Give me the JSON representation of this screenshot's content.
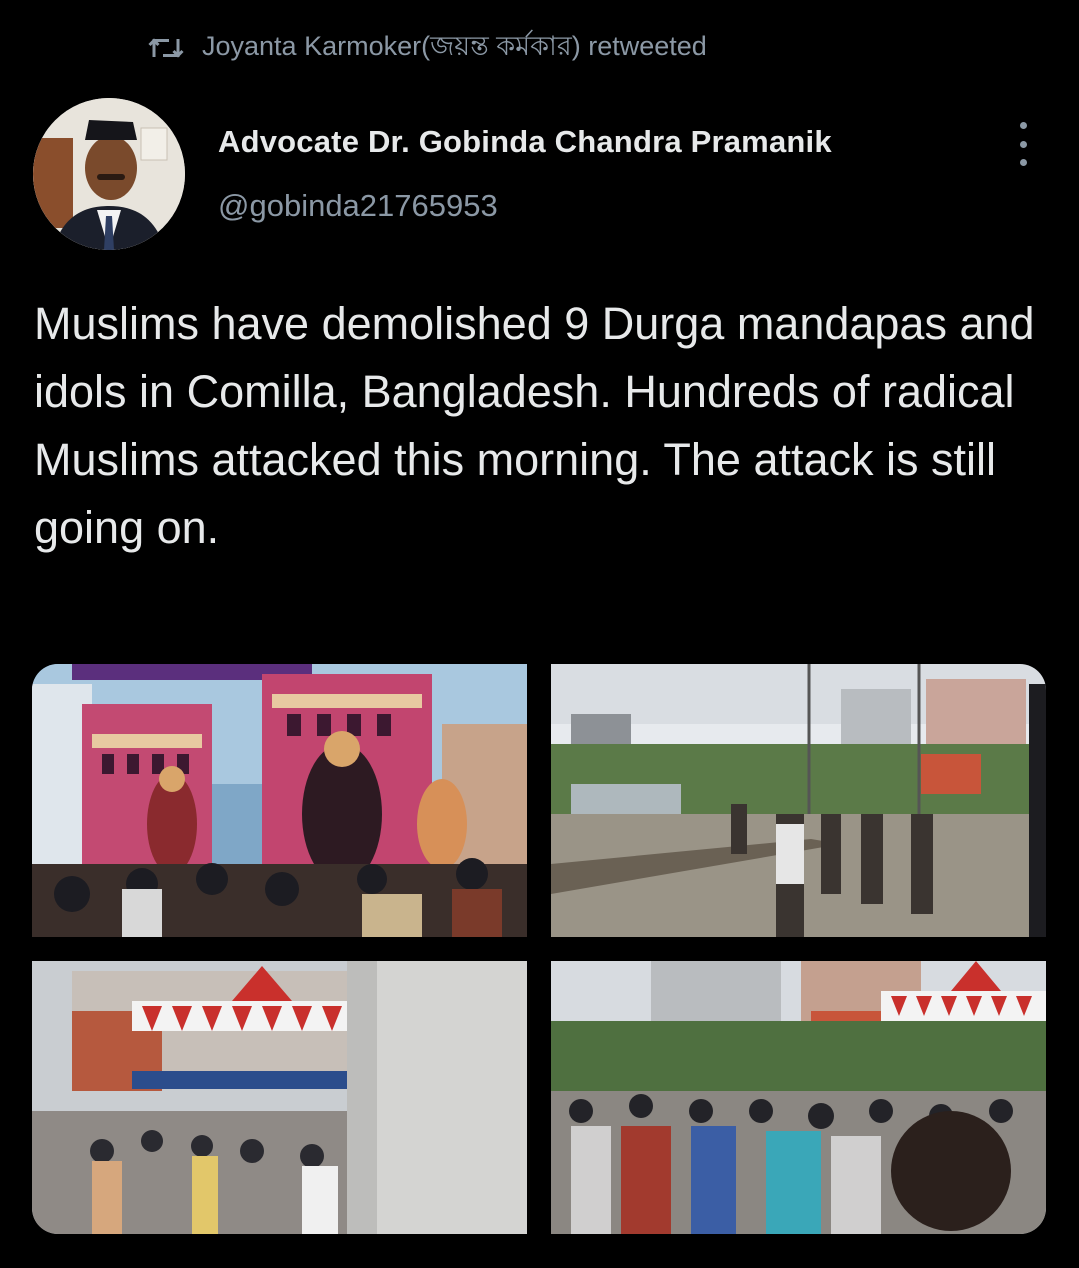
{
  "retweet": {
    "icon": "retweet-icon",
    "text": "Joyanta Karmoker(জয়ন্ত কর্মকার) retweeted"
  },
  "author": {
    "avatar_icon": "avatar",
    "name": "Advocate Dr. Gobinda Chandra Pramanik",
    "handle": "@gobinda21765953"
  },
  "more_icon": "more-options-icon",
  "tweet": {
    "text": "Muslims have demolished 9 Durga mandapas and idols in Comilla, Bangladesh. Hundreds of radical Muslims attacked this morning. The attack is still going on."
  },
  "media": [
    {
      "icon": "photo-mandap-idols"
    },
    {
      "icon": "photo-street-crowd"
    },
    {
      "icon": "photo-pandal-crowd"
    },
    {
      "icon": "photo-crowd-running"
    }
  ],
  "colors": {
    "background": "#000000",
    "text_primary": "#e7e9ea",
    "text_secondary": "#8b98a5"
  }
}
